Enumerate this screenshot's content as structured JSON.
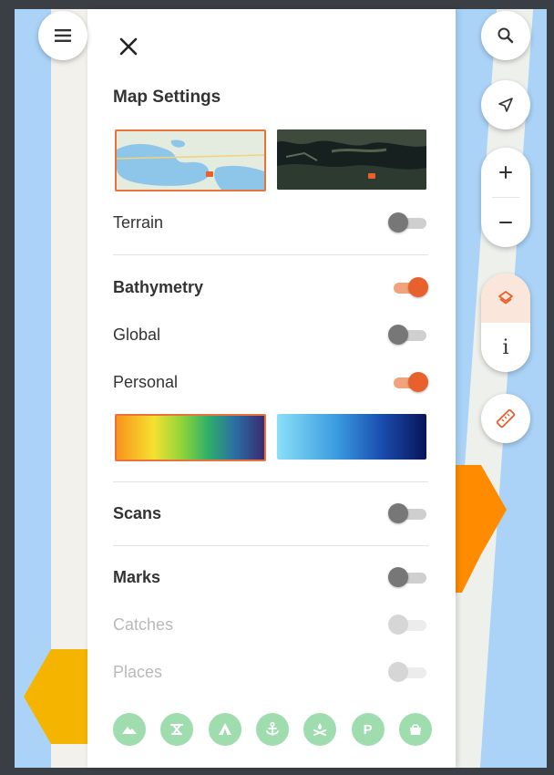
{
  "panel": {
    "title": "Map Settings",
    "rows": {
      "terrain": {
        "label": "Terrain",
        "on": false
      },
      "bathymetry": {
        "label": "Bathymetry",
        "on": true
      },
      "global": {
        "label": "Global",
        "on": false
      },
      "personal": {
        "label": "Personal",
        "on": true
      },
      "scans": {
        "label": "Scans",
        "on": false
      },
      "marks": {
        "label": "Marks",
        "on": false
      },
      "catches": {
        "label": "Catches",
        "on": false,
        "disabled": true
      },
      "places": {
        "label": "Places",
        "on": false,
        "disabled": true
      }
    },
    "map_styles": [
      {
        "name": "map-style-standard",
        "selected": true
      },
      {
        "name": "map-style-satellite",
        "selected": false
      }
    ],
    "color_scales": [
      {
        "name": "rainbow",
        "selected": true
      },
      {
        "name": "blue",
        "selected": false
      }
    ],
    "place_icons": [
      "mountain-icon",
      "tools-icon",
      "tent-icon",
      "anchor-icon",
      "campfire-icon",
      "parking-icon",
      "shop-icon"
    ],
    "parking_letter": "P"
  },
  "controls": {
    "info_label": "i"
  },
  "colors": {
    "accent": "#e8602c",
    "place_icon_bg": "#9fdcae",
    "water": "#aad3f7",
    "hex_yellow": "#f4b400",
    "hex_orange": "#ff8c00"
  }
}
